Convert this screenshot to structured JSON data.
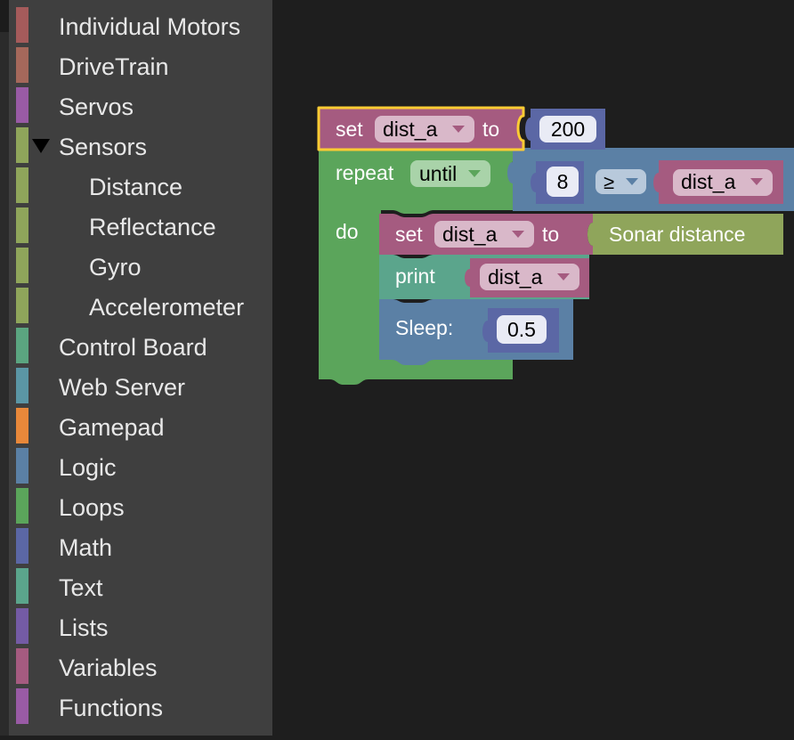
{
  "toolbox": {
    "categories": [
      {
        "label": "Individual Motors",
        "color": "#a55b5b"
      },
      {
        "label": "DriveTrain",
        "color": "#a5685b"
      },
      {
        "label": "Servos",
        "color": "#995ba5"
      },
      {
        "label": "Sensors",
        "color": "#8fa55b",
        "expanded": true
      },
      {
        "label": "Distance",
        "color": "#8fa55b"
      },
      {
        "label": "Reflectance",
        "color": "#8fa55b"
      },
      {
        "label": "Gyro",
        "color": "#8fa55b"
      },
      {
        "label": "Accelerometer",
        "color": "#8fa55b"
      },
      {
        "label": "Control Board",
        "color": "#5ba580"
      },
      {
        "label": "Web Server",
        "color": "#5b96a5"
      },
      {
        "label": "Gamepad",
        "color": "#e8883a"
      },
      {
        "label": "Logic",
        "color": "#5b80a5"
      },
      {
        "label": "Loops",
        "color": "#5ba55b"
      },
      {
        "label": "Math",
        "color": "#5b67a5"
      },
      {
        "label": "Text",
        "color": "#5ba58c"
      },
      {
        "label": "Lists",
        "color": "#745ba5"
      },
      {
        "label": "Variables",
        "color": "#a55b80"
      },
      {
        "label": "Functions",
        "color": "#995ba5"
      }
    ]
  },
  "blocks": {
    "set1": {
      "set": "set",
      "var": "dist_a",
      "to": "to",
      "value": "200"
    },
    "repeat": {
      "repeat": "repeat",
      "mode": "until",
      "do": "do"
    },
    "compare": {
      "left": "8",
      "op": "≥",
      "right_var": "dist_a"
    },
    "set2": {
      "set": "set",
      "var": "dist_a",
      "to": "to",
      "sensor": "Sonar distance"
    },
    "print": {
      "label": "print",
      "var": "dist_a"
    },
    "sleep": {
      "label": "Sleep:",
      "value": "0.5"
    }
  }
}
